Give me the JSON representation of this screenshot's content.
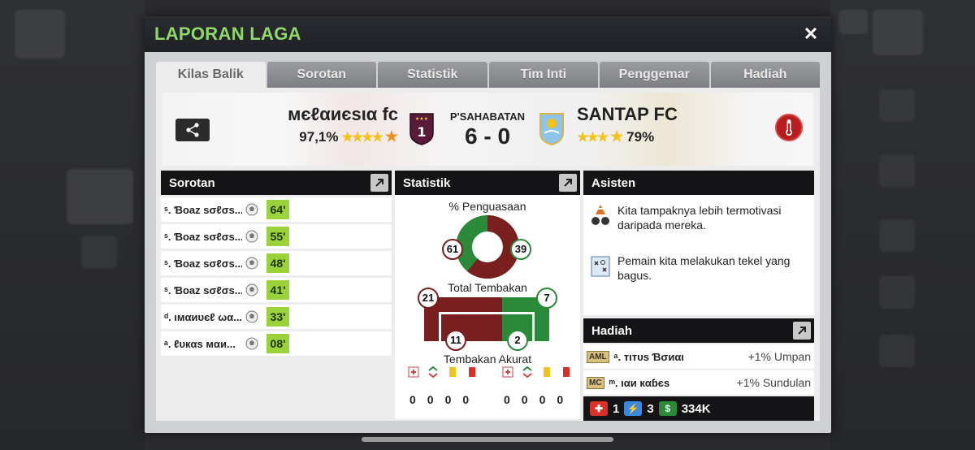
{
  "modal": {
    "title": "LAPORAN LAGA",
    "close_label": "✕"
  },
  "tabs": [
    {
      "label": "Kilas Balik",
      "active": true
    },
    {
      "label": "Sorotan"
    },
    {
      "label": "Statistik"
    },
    {
      "label": "Tim Inti"
    },
    {
      "label": "Penggemar"
    },
    {
      "label": "Hadiah"
    }
  ],
  "match": {
    "home": {
      "name": "мєℓαиєѕια fc",
      "rating": "97,1%"
    },
    "away": {
      "name": "SANTAP FC",
      "rating": "79%"
    },
    "type": "P'SAHABATAN",
    "score": "6 - 0",
    "home_crest_text": "1"
  },
  "highlights": {
    "title": "Sorotan",
    "rows": [
      {
        "player": "ˢ. Ɓoaz ѕσℓσѕ...",
        "minute": "64'"
      },
      {
        "player": "ˢ. Ɓoaz ѕσℓσѕ...",
        "minute": "55'"
      },
      {
        "player": "ˢ. Ɓoaz ѕσℓσѕ...",
        "minute": "48'"
      },
      {
        "player": "ˢ. Ɓoaz ѕσℓσѕ...",
        "minute": "41'"
      },
      {
        "player": "ᵈ. ιмαиυєℓ ωα...",
        "minute": "33'"
      },
      {
        "player": "ᵃ. ℓυкαѕ мαи...",
        "minute": "08'"
      }
    ]
  },
  "stats": {
    "title": "Statistik",
    "possession_label": "% Penguasaan",
    "possession_home": 61,
    "possession_away": 39,
    "shots_label": "Total Tembakan",
    "shots_home": 21,
    "shots_away": 7,
    "accurate_label": "Tembakan Akurat",
    "accurate_home": 11,
    "accurate_away": 2,
    "home_cards": [
      "0",
      "0",
      "0",
      "0"
    ],
    "away_cards": [
      "0",
      "0",
      "0",
      "0"
    ]
  },
  "assistant": {
    "title": "Asisten",
    "tips": [
      {
        "text": "Kita tampaknya lebih termotivasi daripada mereka.",
        "icon": "motivation-icon"
      },
      {
        "text": "Pemain kita melakukan tekel yang bagus.",
        "icon": "tactics-board-icon"
      }
    ]
  },
  "rewards": {
    "title": "Hadiah",
    "rows": [
      {
        "position": "AML",
        "player": "ᵃ. тιтυѕ Ɓσиαι",
        "bonus": "+1% Umpan"
      },
      {
        "position": "MC",
        "player": "ᵐ. ιαи кαɓєѕ",
        "bonus": "+1% Sundulan"
      }
    ],
    "totals": {
      "medical": "1",
      "energy": "3",
      "money": "334K"
    }
  },
  "colors": {
    "home": "#7a1f1f",
    "away": "#2a8a3a",
    "title_green": "#8fd86a",
    "minute_badge": "#9bd23a"
  }
}
